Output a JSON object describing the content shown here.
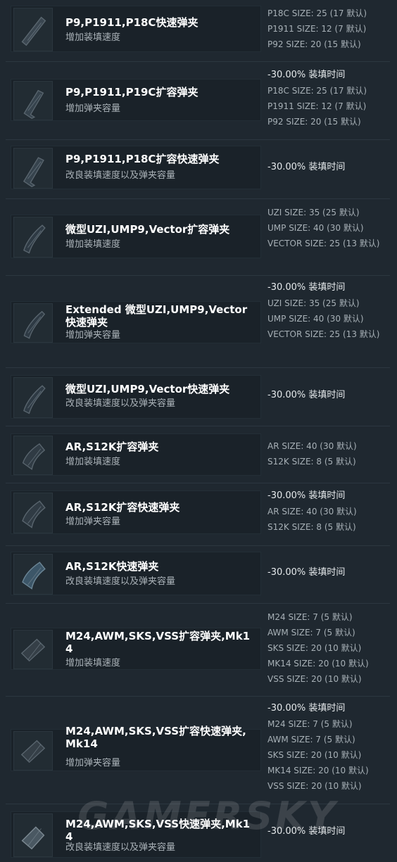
{
  "items": [
    {
      "name": "P9,P1911,P18C快速弹夹",
      "desc": "增加装填速度",
      "stats": [
        "P18C SIZE: 25 (17 默认)",
        "P1911 SIZE: 12 (7 默认)",
        "P92 SIZE: 20 (15 默认)"
      ]
    },
    {
      "name": "P9,P1911,P19C扩容弹夹",
      "desc": "增加弹夹容量",
      "stats": [
        "-30.00% 装填时间",
        "P18C SIZE: 25 (17 默认)",
        "P1911 SIZE: 12 (7 默认)",
        "P92 SIZE: 20 (15 默认)"
      ]
    },
    {
      "name": "P9,P1911,P18C扩容快速弹夹",
      "desc": "改良装填速度以及弹夹容量",
      "stats": [
        "-30.00% 装填时间"
      ]
    },
    {
      "name": "微型UZI,UMP9,Vector扩容弹夹",
      "desc": "增加装填速度",
      "stats": [
        "UZI SIZE: 35 (25 默认)",
        "UMP SIZE: 40 (30 默认)",
        "VECTOR SIZE: 25 (13 默认)"
      ]
    },
    {
      "name": "Extended 微型UZI,UMP9,Vector快速弹夹",
      "desc": "增加弹夹容量",
      "stats": [
        "-30.00% 装填时间",
        "UZI SIZE: 35 (25 默认)",
        "UMP SIZE: 40 (30 默认)",
        "VECTOR SIZE: 25 (13 默认)"
      ]
    },
    {
      "name": "微型UZI,UMP9,Vector快速弹夹",
      "desc": "改良装填速度以及弹夹容量",
      "stats": [
        "-30.00% 装填时间"
      ]
    },
    {
      "name": "AR,S12K扩容弹夹",
      "desc": "增加装填速度",
      "stats": [
        "AR SIZE: 40 (30 默认)",
        "S12K SIZE: 8 (5 默认)"
      ]
    },
    {
      "name": "AR,S12K扩容快速弹夹",
      "desc": "增加弹夹容量",
      "stats": [
        "-30.00% 装填时间",
        "AR SIZE: 40 (30 默认)",
        "S12K SIZE: 8 (5 默认)"
      ]
    },
    {
      "name": "AR,S12K快速弹夹",
      "desc": "改良装填速度以及弹夹容量",
      "stats": [
        "-30.00% 装填时间"
      ]
    },
    {
      "name": "M24,AWM,SKS,VSS扩容弹夹,Mk14",
      "desc": "增加装填速度",
      "stats": [
        "M24 SIZE: 7 (5 默认)",
        "AWM SIZE: 7 (5 默认)",
        "SKS SIZE: 20 (10 默认)",
        "MK14 SIZE: 20 (10 默认)",
        "VSS SIZE: 20 (10 默认)"
      ]
    },
    {
      "name": "M24,AWM,SKS,VSS扩容快速弹夹,Mk14",
      "desc": "增加弹夹容量",
      "stats": [
        "-30.00% 装填时间",
        "M24 SIZE: 7 (5 默认)",
        "AWM SIZE: 7 (5 默认)",
        "SKS SIZE: 20 (10 默认)",
        "MK14 SIZE: 20 (10 默认)",
        "VSS SIZE: 20 (10 默认)"
      ]
    },
    {
      "name": "M24,AWM,SKS,VSS快速弹夹,Mk14",
      "desc": "改良装填速度以及弹夹容量",
      "stats": [
        "-30.00% 装填时间"
      ]
    }
  ],
  "watermark": "GAMERSKY",
  "colors": {
    "background": "#1f2830",
    "card": "#1a2229",
    "title": "#ffffff",
    "description": "#aab2b8",
    "stats": "#a7b0b6"
  }
}
